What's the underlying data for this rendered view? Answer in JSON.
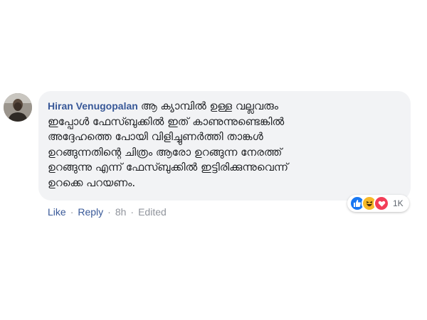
{
  "comment": {
    "author": "Hiran Venugopalan",
    "lines": [
      "ആ ക്യാമ്പിൽ ഉള്ള വല്ലവരും",
      "ഇപ്പോൾ ഫേസ്ബുക്കിൽ ഇത് കാണുന്നുണ്ടെങ്കിൽ",
      "അദ്ദേഹത്തെ പോയി വിളിച്ചുണർത്തി താങ്കൾ",
      "ഉറങ്ങുന്നതിന്റെ ചിത്രം ആരോ ഉറങ്ങുന്ന നേരത്ത്",
      "ഉറങ്ങുന്നു എന്ന് ഫേസ്ബുക്കിൽ ഇട്ടിരിക്കുന്നുവെന്ന്",
      "ഉറക്കെ പറയണം."
    ]
  },
  "reactions": {
    "count": "1K",
    "types": [
      "like-icon",
      "haha-icon",
      "love-icon"
    ],
    "colors": {
      "like": "#1877f2",
      "haha": "#f7b928",
      "love": "#f33e58"
    }
  },
  "actions": {
    "like": "Like",
    "reply": "Reply",
    "separator": "·",
    "time": "8h",
    "edited": "Edited"
  },
  "colors": {
    "bubble": "#f2f3f5",
    "author": "#385898",
    "text": "#1c1e21",
    "meta": "#90949c"
  }
}
